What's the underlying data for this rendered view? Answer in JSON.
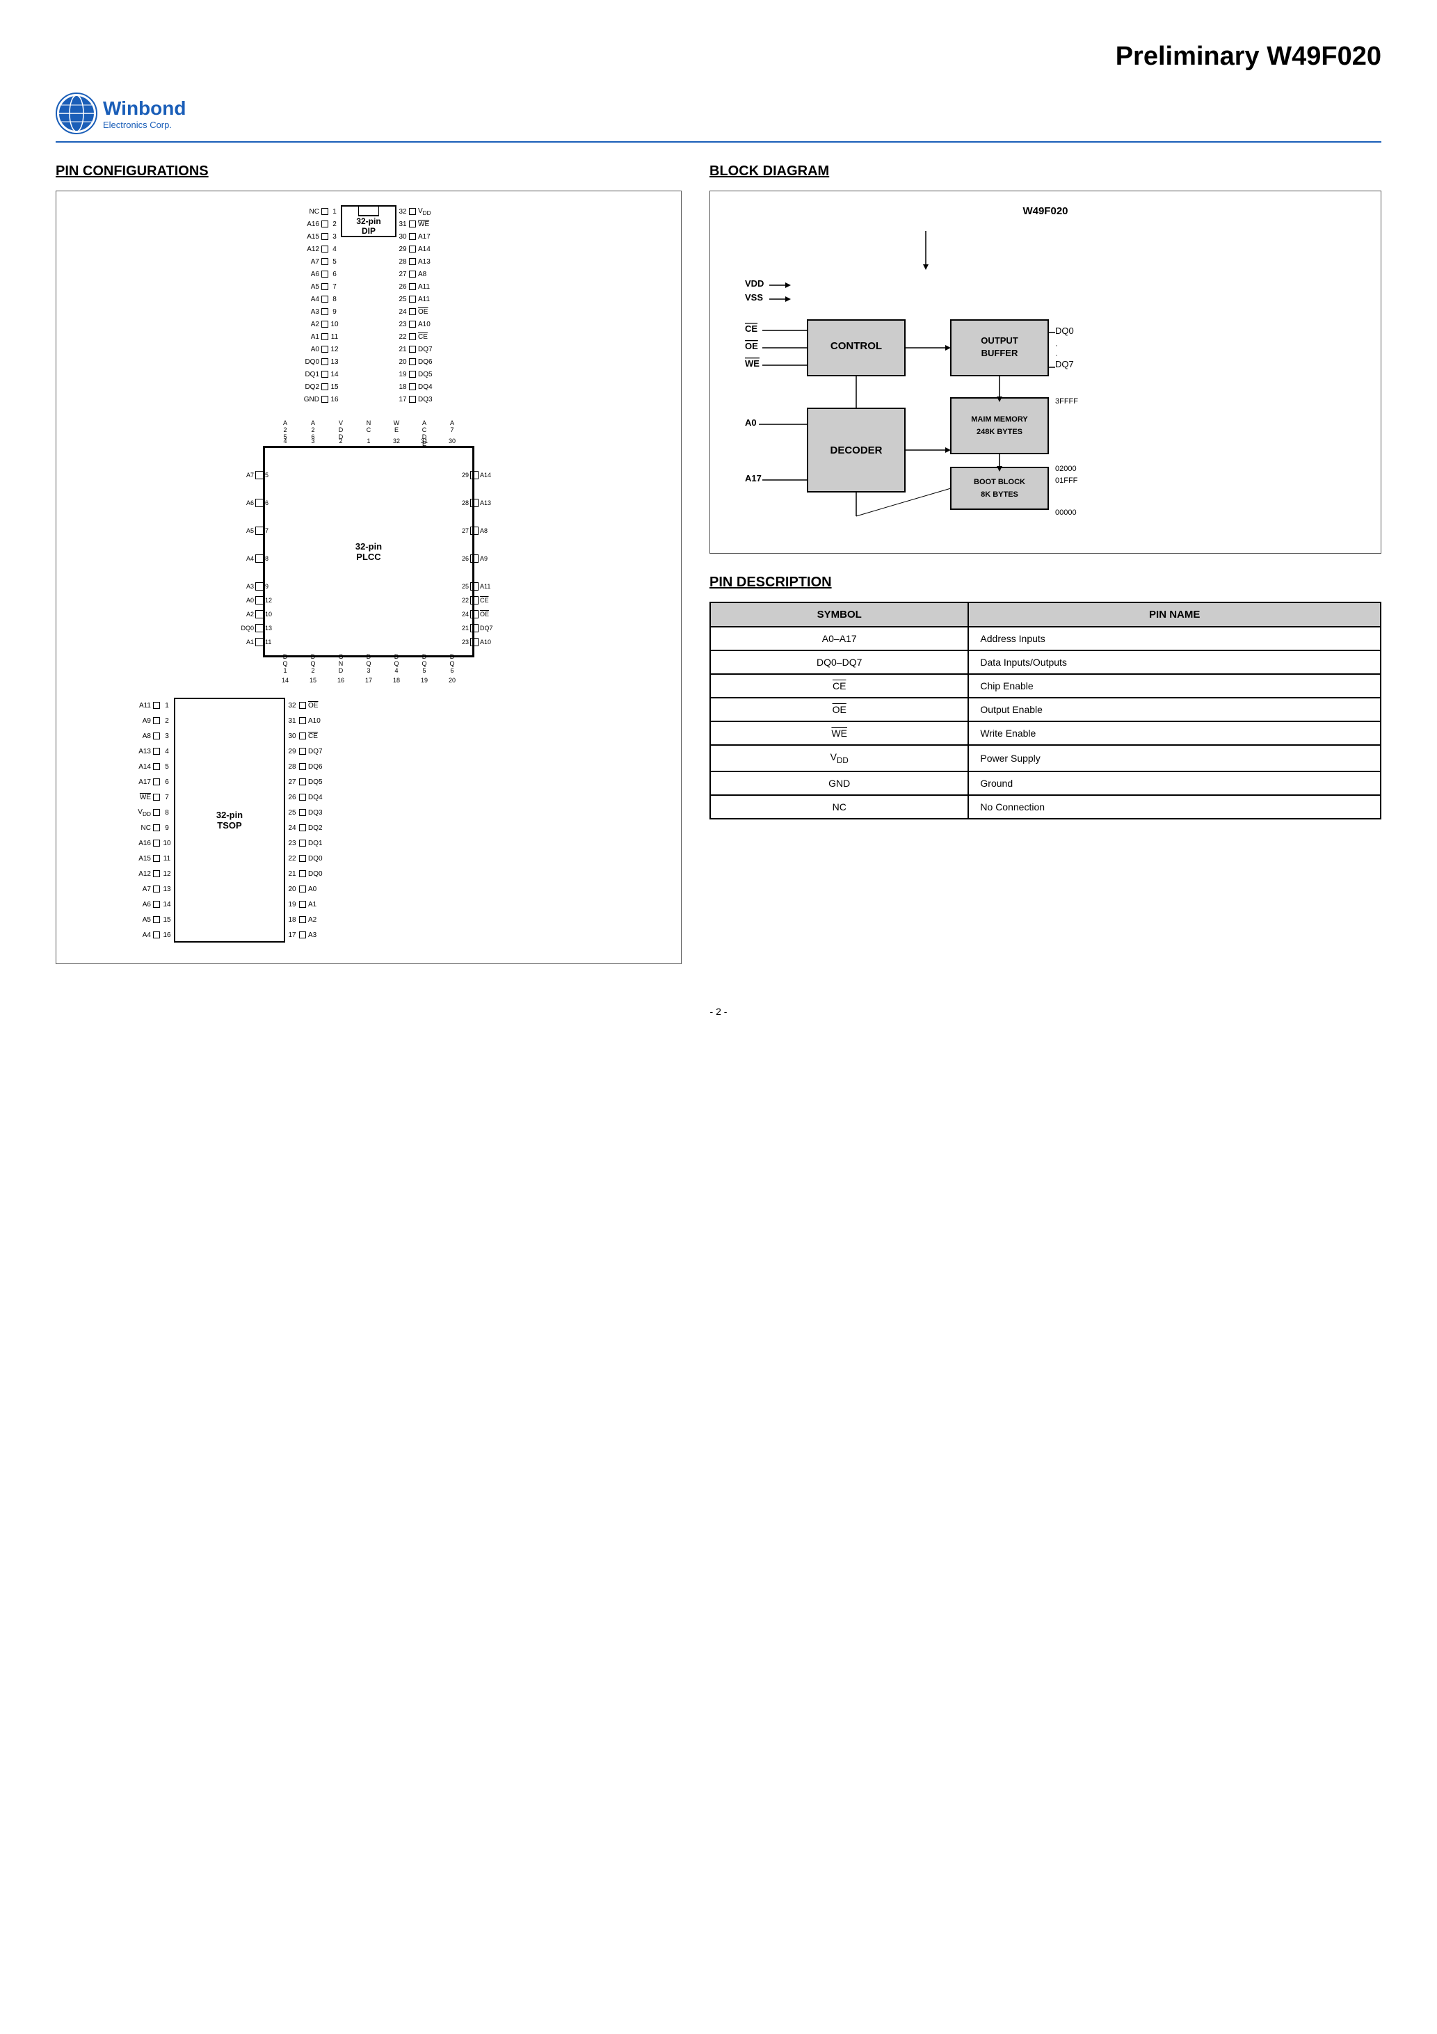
{
  "title": "Preliminary W49F020",
  "logo": {
    "company": "Winbond",
    "sub": "Electronics Corp."
  },
  "sections": {
    "pin_config": "PIN CONFIGURATIONS",
    "block_diagram": "BLOCK DIAGRAM",
    "pin_description": "PIN DESCRIPTION"
  },
  "block_diagram": {
    "chip_name": "W49F020",
    "vdd_label": "VDD",
    "vss_label": "VSS",
    "ce_label": "CE",
    "oe_label": "OE",
    "we_label": "WE",
    "control_label": "CONTROL",
    "output_buffer_label": "OUTPUT\nBUFFER",
    "decoder_label": "DECODER",
    "main_mem_label": "MAIM MEMORY\n248K BYTES",
    "boot_block_label": "BOOT BLOCK\n8K BYTES",
    "dq0_label": "DQ0",
    "dq7_label": "DQ7",
    "a0_label": "A0",
    "a17_label": "A17",
    "addr_3ffff": "3FFFF",
    "addr_02000": "02000",
    "addr_01fff": "01FFF",
    "addr_00000": "00000"
  },
  "dip_pins_left": [
    {
      "num": "1",
      "name": "NC"
    },
    {
      "num": "2",
      "name": "A16"
    },
    {
      "num": "3",
      "name": "A15"
    },
    {
      "num": "4",
      "name": "A12"
    },
    {
      "num": "5",
      "name": "A7"
    },
    {
      "num": "6",
      "name": "A6"
    },
    {
      "num": "7",
      "name": "A5"
    },
    {
      "num": "8",
      "name": "A4"
    },
    {
      "num": "9",
      "name": "A3"
    },
    {
      "num": "10",
      "name": "A2"
    },
    {
      "num": "11",
      "name": "A1"
    },
    {
      "num": "12",
      "name": "A0"
    },
    {
      "num": "13",
      "name": "DQ0"
    },
    {
      "num": "14",
      "name": "DQ1"
    },
    {
      "num": "15",
      "name": "DQ2"
    },
    {
      "num": "16",
      "name": "GND"
    }
  ],
  "dip_pins_right": [
    {
      "num": "32",
      "name": "VDD"
    },
    {
      "num": "31",
      "name": "WE"
    },
    {
      "num": "30",
      "name": "A17"
    },
    {
      "num": "29",
      "name": "A14"
    },
    {
      "num": "28",
      "name": "A13"
    },
    {
      "num": "27",
      "name": "A8"
    },
    {
      "num": "26",
      "name": "A11"
    },
    {
      "num": "25",
      "name": "A11"
    },
    {
      "num": "24",
      "name": "OE"
    },
    {
      "num": "23",
      "name": "A10"
    },
    {
      "num": "22",
      "name": "CE"
    },
    {
      "num": "21",
      "name": "DQ7"
    },
    {
      "num": "20",
      "name": "DQ6"
    },
    {
      "num": "19",
      "name": "DQ5"
    },
    {
      "num": "18",
      "name": "DQ4"
    },
    {
      "num": "17",
      "name": "DQ3"
    }
  ],
  "dip_chip_label": "32-pin\nDIP",
  "plcc_chip_label": "32-pin\nPLCC",
  "tsop_chip_label": "32-pin\nTSOP",
  "pin_table": {
    "headers": [
      "SYMBOL",
      "PIN NAME"
    ],
    "rows": [
      {
        "symbol": "A0–A17",
        "pin_name": "Address Inputs"
      },
      {
        "symbol": "DQ0–DQ7",
        "pin_name": "Data Inputs/Outputs"
      },
      {
        "symbol": "CE",
        "pin_name": "Chip Enable",
        "overline": true
      },
      {
        "symbol": "OE",
        "pin_name": "Output Enable",
        "overline": true
      },
      {
        "symbol": "WE",
        "pin_name": "Write Enable",
        "overline": true
      },
      {
        "symbol": "VDD",
        "pin_name": "Power Supply"
      },
      {
        "symbol": "GND",
        "pin_name": "Ground"
      },
      {
        "symbol": "NC",
        "pin_name": "No Connection"
      }
    ]
  },
  "page_number": "- 2 -"
}
